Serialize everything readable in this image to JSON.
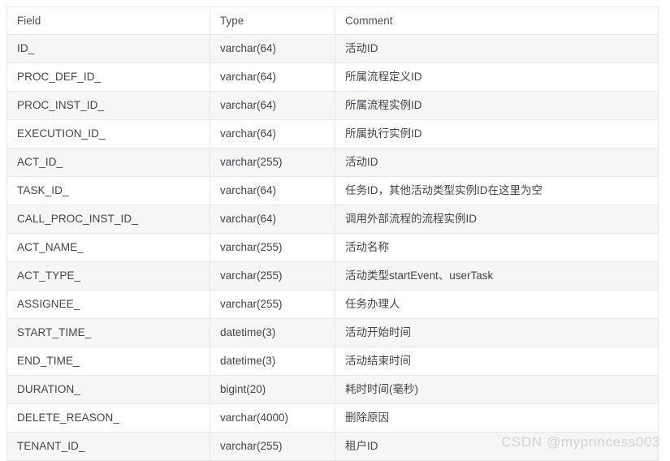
{
  "table": {
    "columns": [
      {
        "key": "field",
        "label": "Field"
      },
      {
        "key": "type",
        "label": "Type"
      },
      {
        "key": "comment",
        "label": "Comment"
      }
    ],
    "rows": [
      {
        "field": "ID_",
        "type": "varchar(64)",
        "comment": "活动ID"
      },
      {
        "field": "PROC_DEF_ID_",
        "type": "varchar(64)",
        "comment": "所属流程定义ID"
      },
      {
        "field": "PROC_INST_ID_",
        "type": "varchar(64)",
        "comment": "所属流程实例ID"
      },
      {
        "field": "EXECUTION_ID_",
        "type": "varchar(64)",
        "comment": "所属执行实例ID"
      },
      {
        "field": "ACT_ID_",
        "type": "varchar(255)",
        "comment": "活动ID"
      },
      {
        "field": "TASK_ID_",
        "type": "varchar(64)",
        "comment": "任务ID，其他活动类型实例ID在这里为空"
      },
      {
        "field": "CALL_PROC_INST_ID_",
        "type": "varchar(64)",
        "comment": "调用外部流程的流程实例ID"
      },
      {
        "field": "ACT_NAME_",
        "type": "varchar(255)",
        "comment": "活动名称"
      },
      {
        "field": "ACT_TYPE_",
        "type": "varchar(255)",
        "comment": "活动类型startEvent、userTask"
      },
      {
        "field": "ASSIGNEE_",
        "type": "varchar(255)",
        "comment": "任务办理人"
      },
      {
        "field": "START_TIME_",
        "type": "datetime(3)",
        "comment": "活动开始时间"
      },
      {
        "field": "END_TIME_",
        "type": "datetime(3)",
        "comment": "活动结束时间"
      },
      {
        "field": "DURATION_",
        "type": "bigint(20)",
        "comment": "耗时时间(毫秒)"
      },
      {
        "field": "DELETE_REASON_",
        "type": "varchar(4000)",
        "comment": "删除原因"
      },
      {
        "field": "TENANT_ID_",
        "type": "varchar(255)",
        "comment": "租户ID"
      }
    ]
  },
  "watermark": {
    "text": "CSDN @myprincess003"
  },
  "colors": {
    "border": "#e6e6e6",
    "row_alt_background": "#f6f6f6",
    "row_background": "#ffffff",
    "text": "#41464b",
    "header_text": "#4b5059",
    "watermark_text": "#d2d2d2"
  }
}
